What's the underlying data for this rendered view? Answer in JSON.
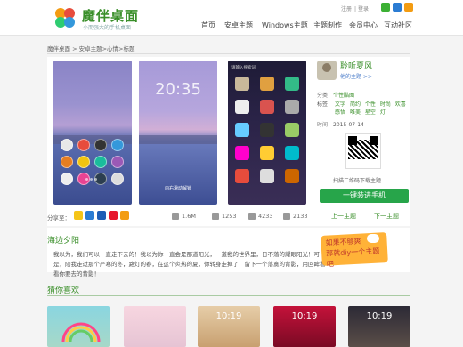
{
  "brand": {
    "title": "魔伴桌面",
    "subtitle": "小而强大的手机桌面"
  },
  "top_links": [
    "注册",
    "登录"
  ],
  "nav": [
    "首页",
    "安卓主题",
    "Windows主题",
    "主题制作",
    "会员中心",
    "互动社区"
  ],
  "breadcrumb": "魔伴桌面 > 安卓主题>心情>标题",
  "screenshots": {
    "clock": "20:35",
    "unlock_hint": "向右滑动解锁",
    "search_placeholder": "请输入搜索词"
  },
  "stats": {
    "share_label": "分享至：",
    "size": "1.6M",
    "likes": "1253",
    "views": "4233",
    "downloads": "2133"
  },
  "sidebar": {
    "author": "聆听夏风",
    "author_link": "他的主题 >>",
    "category_label": "分类：",
    "category": "个性酷图",
    "tags_label": "标签：",
    "tags": [
      "文字",
      "简约",
      "个性",
      "时尚",
      "欢喜",
      "感悟",
      "唯美",
      "星空",
      "灯"
    ],
    "date_label": "时间：",
    "date": "2015-07-14",
    "qr_caption": "扫描二维码下载主题",
    "install_button": "一键装进手机",
    "prev": "上一主题",
    "next": "下一主题"
  },
  "theme": {
    "title": "海边夕阳",
    "description": "我以为，我们可以一直走下去的！我以为你一直会是那道阳光，一道我的世界里，日不落的耀眼阳光！可是，陪我走过那个严寒的冬，路灯的春，在这个炎热的夏，你转身走掉了！留下一个落寞的背影，用回眸看看你要去的背影！"
  },
  "promo": {
    "line1": "如果不够爽",
    "line2": "那就diy一个主题吧"
  },
  "guess": {
    "title": "猜你喜欢",
    "items": [
      {
        "clock": ""
      },
      {
        "clock": ""
      },
      {
        "clock": "10:19"
      },
      {
        "clock": "10:19"
      },
      {
        "clock": "10:19"
      }
    ]
  },
  "colors": {
    "accent": "#3a8f2a",
    "install": "#27a54a",
    "promo": "#ffb238"
  }
}
